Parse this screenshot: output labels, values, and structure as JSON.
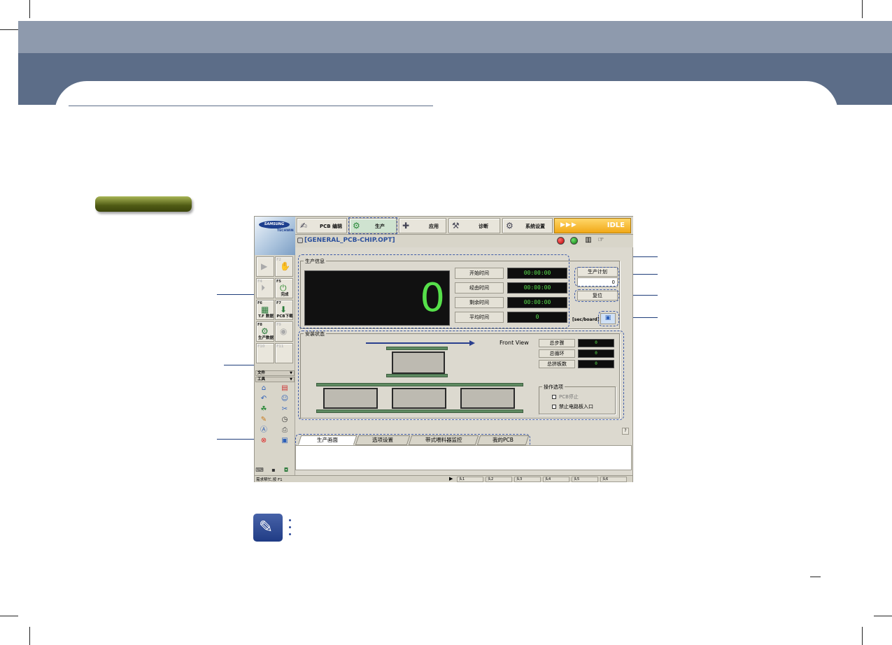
{
  "app": {
    "toolbar": [
      {
        "label": "PCB 编辑",
        "icon": "pcb-edit-icon"
      },
      {
        "label": "生产",
        "icon": "production-gear-icon"
      },
      {
        "label": "应用",
        "icon": "application-icon"
      },
      {
        "label": "诊断",
        "icon": "diagnosis-icon"
      },
      {
        "label": "系统设置",
        "icon": "system-settings-icon"
      }
    ],
    "status": "IDLE",
    "status_arrows": "▶▶▶",
    "file_name": "[GENERAL_PCB-CHIP.OPT]",
    "logo": {
      "brand": "SAMSUNG",
      "sub": "TECHWIN"
    },
    "side_buttons": [
      {
        "fkey": "",
        "label": "",
        "icon": "play-icon"
      },
      {
        "fkey": "F2",
        "label": "",
        "icon": "hand-stop-icon"
      },
      {
        "fkey": "F4",
        "label": "",
        "icon": "step-icon"
      },
      {
        "fkey": "F5",
        "label": "完成",
        "icon": "finish-icon"
      },
      {
        "fkey": "F6",
        "label": "T.F 数据",
        "icon": "tf-data-icon"
      },
      {
        "fkey": "F7",
        "label": "PCB下载",
        "icon": "pcb-download-icon"
      },
      {
        "fkey": "F8",
        "label": "生产数据",
        "icon": "production-data-icon"
      },
      {
        "fkey": "F9",
        "label": "",
        "icon": "feeder-icon"
      },
      {
        "fkey": "F10",
        "label": "",
        "icon": ""
      },
      {
        "fkey": "F11",
        "label": "",
        "icon": ""
      }
    ],
    "menus": [
      "文件",
      "工具"
    ],
    "production_info": {
      "title": "生产信息",
      "counter": "0",
      "rows": [
        {
          "label": "开始时间",
          "value": "00:00:00"
        },
        {
          "label": "经由时间",
          "value": "00:00:00"
        },
        {
          "label": "剩余时间",
          "value": "00:00:00"
        },
        {
          "label": "平均时间",
          "value": "0"
        }
      ],
      "plan_button": "生产计划",
      "plan_value": "0",
      "reset_button": "复位",
      "unit_label": "[sec/board]"
    },
    "mount_status": {
      "title": "安装状态",
      "view_label": "Front View",
      "stats": [
        {
          "label": "总步骤",
          "value": "0"
        },
        {
          "label": "总循环",
          "value": "0"
        },
        {
          "label": "总拼板数",
          "value": "0"
        }
      ],
      "options_title": "操作选项",
      "options": [
        "PCB停止",
        "禁止电路板入口"
      ]
    },
    "help_button": "?",
    "tabs": [
      "生产画面",
      "选项设置",
      "带式喂料器监控",
      "我的PCB"
    ],
    "status_text": "需求帮忙,按 F1",
    "heads": [
      "头1",
      "头2",
      "头3",
      "头4",
      "头5",
      "头6"
    ]
  },
  "colors": {
    "header_top": "#8e9aad",
    "header_band": "#5c6d88",
    "idle_bg": "#f1a817",
    "display_digits": "#58e04c",
    "callout": "#1f3d7a"
  }
}
